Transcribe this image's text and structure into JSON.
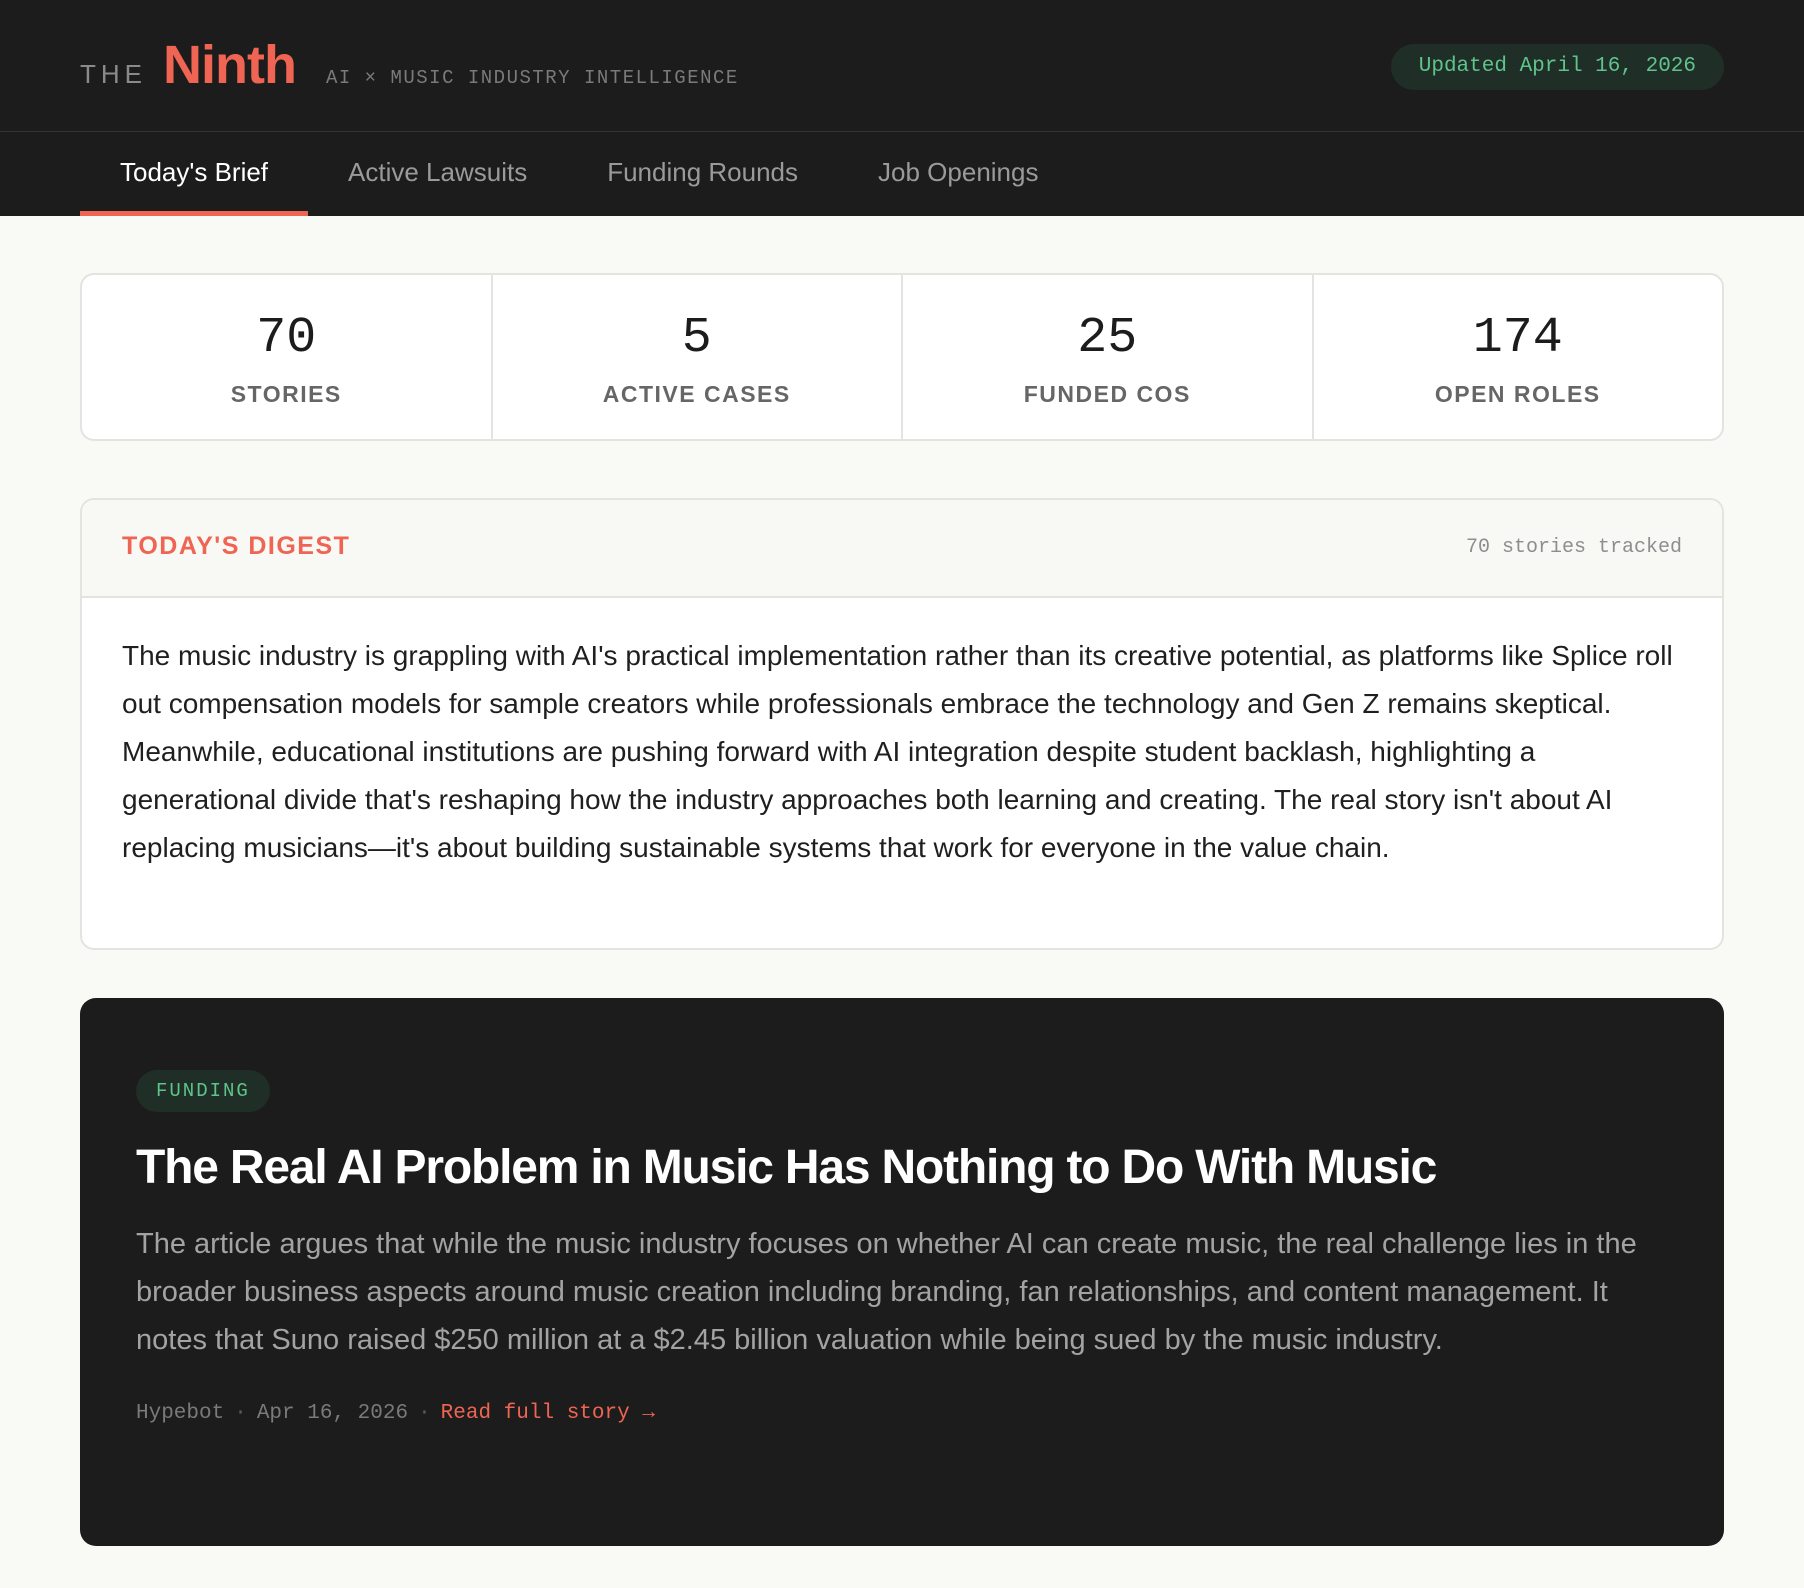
{
  "header": {
    "brand_prefix": "THE",
    "brand_name": "Ninth",
    "tagline": "AI × MUSIC INDUSTRY INTELLIGENCE",
    "updated": "Updated April 16, 2026"
  },
  "nav": {
    "tabs": [
      {
        "label": "Today's Brief",
        "active": true
      },
      {
        "label": "Active Lawsuits",
        "active": false
      },
      {
        "label": "Funding Rounds",
        "active": false
      },
      {
        "label": "Job Openings",
        "active": false
      }
    ]
  },
  "stats": [
    {
      "value": "70",
      "label": "STORIES"
    },
    {
      "value": "5",
      "label": "ACTIVE CASES"
    },
    {
      "value": "25",
      "label": "FUNDED COS"
    },
    {
      "value": "174",
      "label": "OPEN ROLES"
    }
  ],
  "digest": {
    "title": "TODAY'S DIGEST",
    "count": "70 stories tracked",
    "body": "The music industry is grappling with AI's practical implementation rather than its creative potential, as platforms like Splice roll out compensation models for sample creators while professionals embrace the technology and Gen Z remains skeptical. Meanwhile, educational institutions are pushing forward with AI integration despite student backlash, highlighting a generational divide that's reshaping how the industry approaches both learning and creating. The real story isn't about AI replacing musicians—it's about building sustainable systems that work for everyone in the value chain."
  },
  "featured": {
    "tag": "FUNDING",
    "headline": "The Real AI Problem in Music Has Nothing to Do With Music",
    "summary": "The article argues that while the music industry focuses on whether AI can create music, the real challenge lies in the broader business aspects around music creation including branding, fan relationships, and content management. It notes that Suno raised $250 million at a $2.45 billion valuation while being sued by the music industry.",
    "source": "Hypebot",
    "date": "Apr 16, 2026",
    "separator": "·",
    "link_label": "Read full story →"
  },
  "colors": {
    "accent": "#ef6452",
    "dark_bg": "#1c1c1c",
    "green_text": "#5fc48c",
    "green_bg": "#1f2e26",
    "page_bg": "#f9f9f6"
  }
}
